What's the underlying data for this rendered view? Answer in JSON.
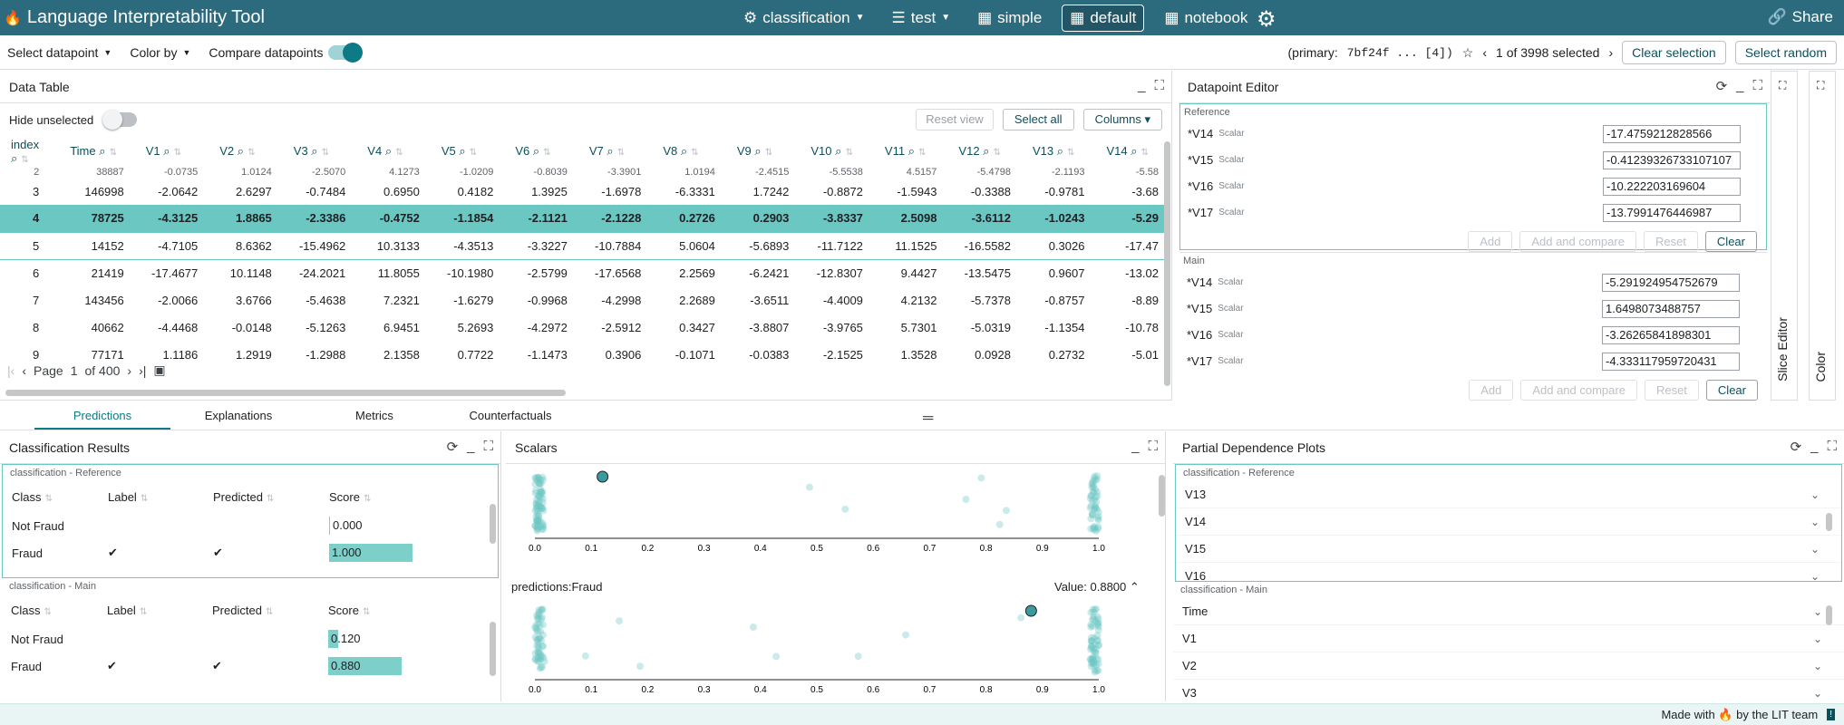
{
  "app": {
    "title": "Language Interpretability Tool",
    "share_label": "Share"
  },
  "nav": {
    "model": "classification",
    "dataset": "test",
    "layouts": [
      "simple",
      "default",
      "notebook"
    ],
    "active_layout": "default"
  },
  "toolbar": {
    "select_datapoint": "Select datapoint",
    "color_by": "Color by",
    "compare": "Compare datapoints",
    "primary_label": "(primary:",
    "primary_id": "7bf24f ... [4])",
    "selected_info": "1 of 3998 selected",
    "clear_selection": "Clear selection",
    "select_random": "Select random"
  },
  "data_table": {
    "title": "Data Table",
    "hide_unselected": "Hide unselected",
    "reset_view": "Reset view",
    "select_all": "Select all",
    "columns": "Columns",
    "headers": [
      "index",
      "Time",
      "V1",
      "V2",
      "V3",
      "V4",
      "V5",
      "V6",
      "V7",
      "V8",
      "V9",
      "V10",
      "V11",
      "V12",
      "V13",
      "V14"
    ],
    "partial_row": [
      "2",
      "38887",
      "-0.0735",
      "1.0124",
      "-2.5070",
      "4.1273",
      "-1.0209",
      "-0.8039",
      "-3.3901",
      "1.0194",
      "-2.4515",
      "-5.5538",
      "4.5157",
      "-5.4798",
      "-2.1193",
      "-5.58"
    ],
    "rows": [
      [
        "3",
        "146998",
        "-2.0642",
        "2.6297",
        "-0.7484",
        "0.6950",
        "0.4182",
        "1.3925",
        "-1.6978",
        "-6.3331",
        "1.7242",
        "-0.8872",
        "-1.5943",
        "-0.3388",
        "-0.9781",
        "-3.68"
      ],
      [
        "4",
        "78725",
        "-4.3125",
        "1.8865",
        "-2.3386",
        "-0.4752",
        "-1.1854",
        "-2.1121",
        "-2.1228",
        "0.2726",
        "0.2903",
        "-3.8337",
        "2.5098",
        "-3.6112",
        "-1.0243",
        "-5.29"
      ],
      [
        "5",
        "14152",
        "-4.7105",
        "8.6362",
        "-15.4962",
        "10.3133",
        "-4.3513",
        "-3.3227",
        "-10.7884",
        "5.0604",
        "-5.6893",
        "-11.7122",
        "11.1525",
        "-16.5582",
        "0.3026",
        "-17.47"
      ],
      [
        "6",
        "21419",
        "-17.4677",
        "10.1148",
        "-24.2021",
        "11.8055",
        "-10.1980",
        "-2.5799",
        "-17.6568",
        "2.2569",
        "-6.2421",
        "-12.8307",
        "9.4427",
        "-13.5475",
        "0.9607",
        "-13.02"
      ],
      [
        "7",
        "143456",
        "-2.0066",
        "3.6766",
        "-5.4638",
        "7.2321",
        "-1.6279",
        "-0.9968",
        "-4.2998",
        "2.2689",
        "-3.6511",
        "-4.4009",
        "4.2132",
        "-5.7378",
        "-0.8757",
        "-8.89"
      ],
      [
        "8",
        "40662",
        "-4.4468",
        "-0.0148",
        "-5.1263",
        "6.9451",
        "5.2693",
        "-4.2972",
        "-2.5912",
        "0.3427",
        "-3.8807",
        "-3.9765",
        "5.7301",
        "-5.0319",
        "-1.1354",
        "-10.78"
      ],
      [
        "9",
        "77171",
        "1.1186",
        "1.2919",
        "-1.2988",
        "2.1358",
        "0.7722",
        "-1.1473",
        "0.3906",
        "-0.1071",
        "-0.0383",
        "-2.1525",
        "1.3528",
        "0.0928",
        "0.2732",
        "-5.01"
      ]
    ],
    "page_label": "Page",
    "page": "1",
    "of_pages": "of 400"
  },
  "datapoint_editor": {
    "title": "Datapoint Editor",
    "reference_label": "Reference",
    "main_label": "Main",
    "type_label": "Scalar",
    "reference_rows": [
      {
        "name": "*V14",
        "value": "-17.4759212828566"
      },
      {
        "name": "*V15",
        "value": "-0.41239326733107107"
      },
      {
        "name": "*V16",
        "value": "-10.222203169604"
      },
      {
        "name": "*V17",
        "value": "-13.7991476446987"
      }
    ],
    "main_rows": [
      {
        "name": "*V14",
        "value": "-5.291924954752679"
      },
      {
        "name": "*V15",
        "value": "1.6498073488757"
      },
      {
        "name": "*V16",
        "value": "-3.26265841898301"
      },
      {
        "name": "*V17",
        "value": "-4.333117959720431"
      }
    ],
    "actions": [
      "Add",
      "Add and compare",
      "Reset",
      "Clear"
    ]
  },
  "side_tabs": [
    "Slice Editor",
    "Color"
  ],
  "tabs": [
    "Predictions",
    "Explanations",
    "Metrics",
    "Counterfactuals"
  ],
  "classification_results": {
    "title": "Classification Results",
    "reference_label": "classification - Reference",
    "main_label": "classification - Main",
    "headers": [
      "Class",
      "Label",
      "Predicted",
      "Score"
    ],
    "reference_rows": [
      {
        "class": "Not Fraud",
        "label": "",
        "predicted": "",
        "score": "0.000",
        "fill": 0.0
      },
      {
        "class": "Fraud",
        "label": "✔",
        "predicted": "✔",
        "score": "1.000",
        "fill": 1.0
      }
    ],
    "main_rows": [
      {
        "class": "Not Fraud",
        "label": "",
        "predicted": "",
        "score": "0.120",
        "fill": 0.12
      },
      {
        "class": "Fraud",
        "label": "✔",
        "predicted": "✔",
        "score": "0.880",
        "fill": 0.88
      }
    ]
  },
  "scalars": {
    "title": "Scalars",
    "plot2_label": "predictions:Fraud",
    "plot2_value": "Value: 0.8800",
    "ticks": [
      "0.0",
      "0.1",
      "0.2",
      "0.3",
      "0.4",
      "0.5",
      "0.6",
      "0.7",
      "0.8",
      "0.9",
      "1.0"
    ],
    "plot1_highlight": 0.12,
    "plot2_highlight": 0.88
  },
  "pdp": {
    "title": "Partial Dependence Plots",
    "reference_label": "classification - Reference",
    "main_label": "classification - Main",
    "reference_features": [
      "V13",
      "V14",
      "V15",
      "V16"
    ],
    "main_features": [
      "Time",
      "V1",
      "V2",
      "V3"
    ]
  },
  "footer": {
    "text": "Made with 🔥 by the LIT team"
  },
  "colors": {
    "header": "#2c6b7d",
    "accent": "#0e7a86",
    "selection": "#6ac7c2",
    "bar": "#7dd0ca"
  }
}
